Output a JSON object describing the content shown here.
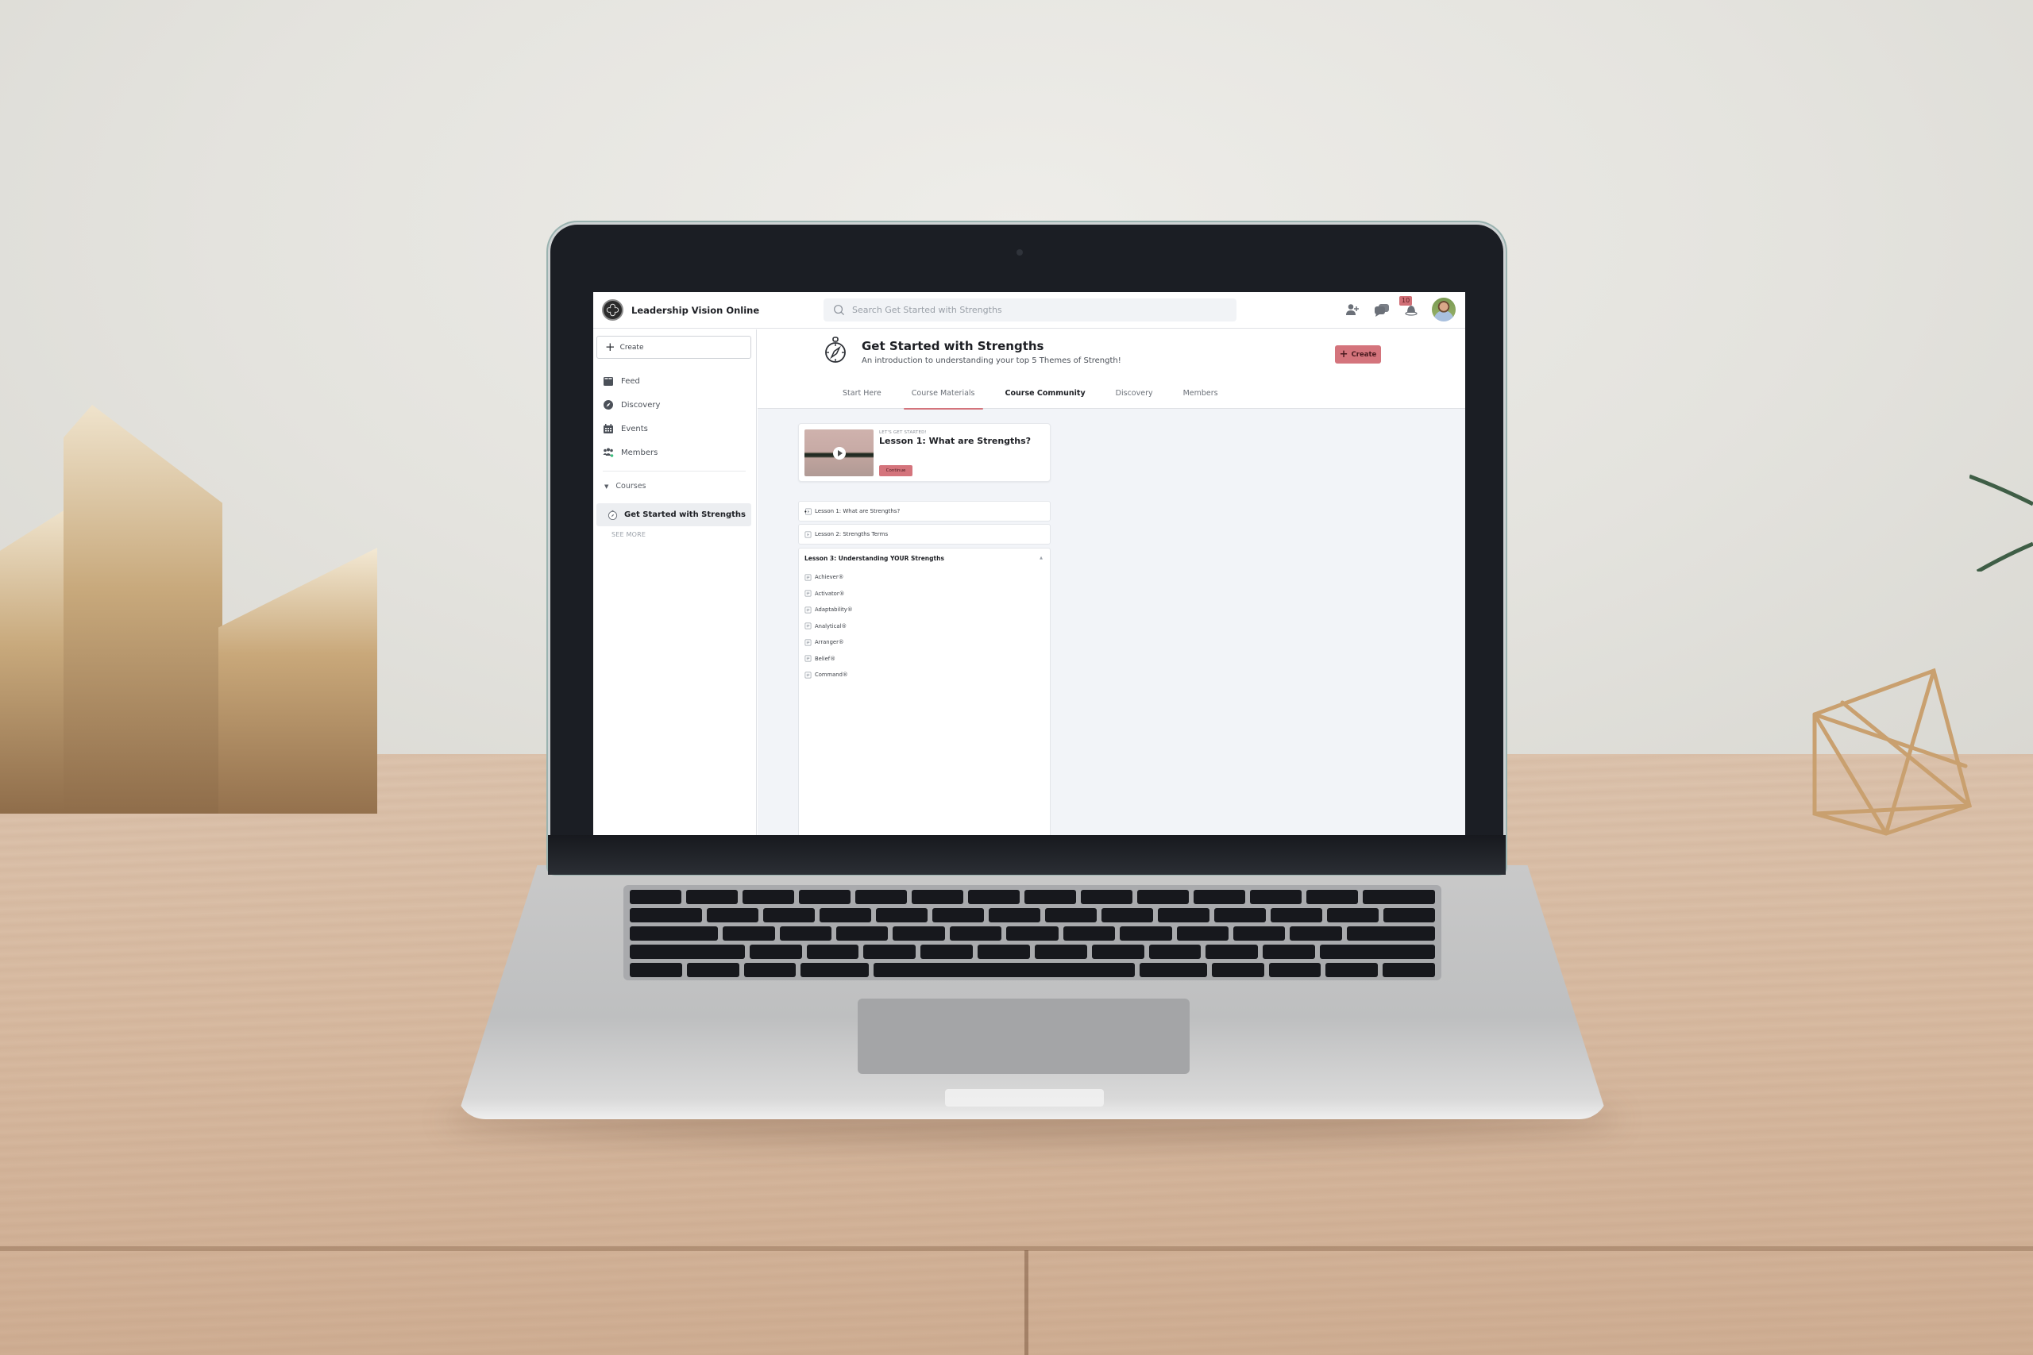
{
  "app": {
    "brand_name": "Leadership Vision Online",
    "search_placeholder": "Search Get Started with Strengths",
    "notifications_count": "10"
  },
  "sidebar": {
    "create_label": "Create",
    "items": [
      {
        "label": "Feed",
        "icon": "feed-icon"
      },
      {
        "label": "Discovery",
        "icon": "compass-icon"
      },
      {
        "label": "Events",
        "icon": "calendar-icon"
      },
      {
        "label": "Members",
        "icon": "members-icon"
      }
    ],
    "courses_label": "Courses",
    "active_course": "Get Started with Strengths",
    "see_more": "SEE MORE"
  },
  "course": {
    "title": "Get Started with Strengths",
    "subtitle": "An introduction to understanding your top 5 Themes of Strength!",
    "create_label": "Create",
    "tabs": [
      {
        "label": "Start Here",
        "state": "normal"
      },
      {
        "label": "Course Materials",
        "state": "active"
      },
      {
        "label": "Course Community",
        "state": "bold"
      },
      {
        "label": "Discovery",
        "state": "normal"
      },
      {
        "label": "Members",
        "state": "normal"
      }
    ]
  },
  "featured_lesson": {
    "eyebrow": "LET'S GET STARTED!",
    "title": "Lesson 1: What are Strengths?",
    "continue_label": "Continue"
  },
  "lessons": [
    {
      "title": "Lesson 1: What are Strengths?",
      "type": "video",
      "in_progress": true
    },
    {
      "title": "Lesson 2: Strengths Terms",
      "type": "video"
    },
    {
      "title": "Lesson 3: Understanding YOUR Strengths",
      "expanded": true,
      "items": [
        "Achiever®",
        "Activator®",
        "Adaptability®",
        "Analytical®",
        "Arranger®",
        "Belief®",
        "Command®"
      ]
    }
  ],
  "colors": {
    "accent": "#d4747c",
    "page_bg": "#f2f4f8",
    "text": "#1d1f24"
  }
}
